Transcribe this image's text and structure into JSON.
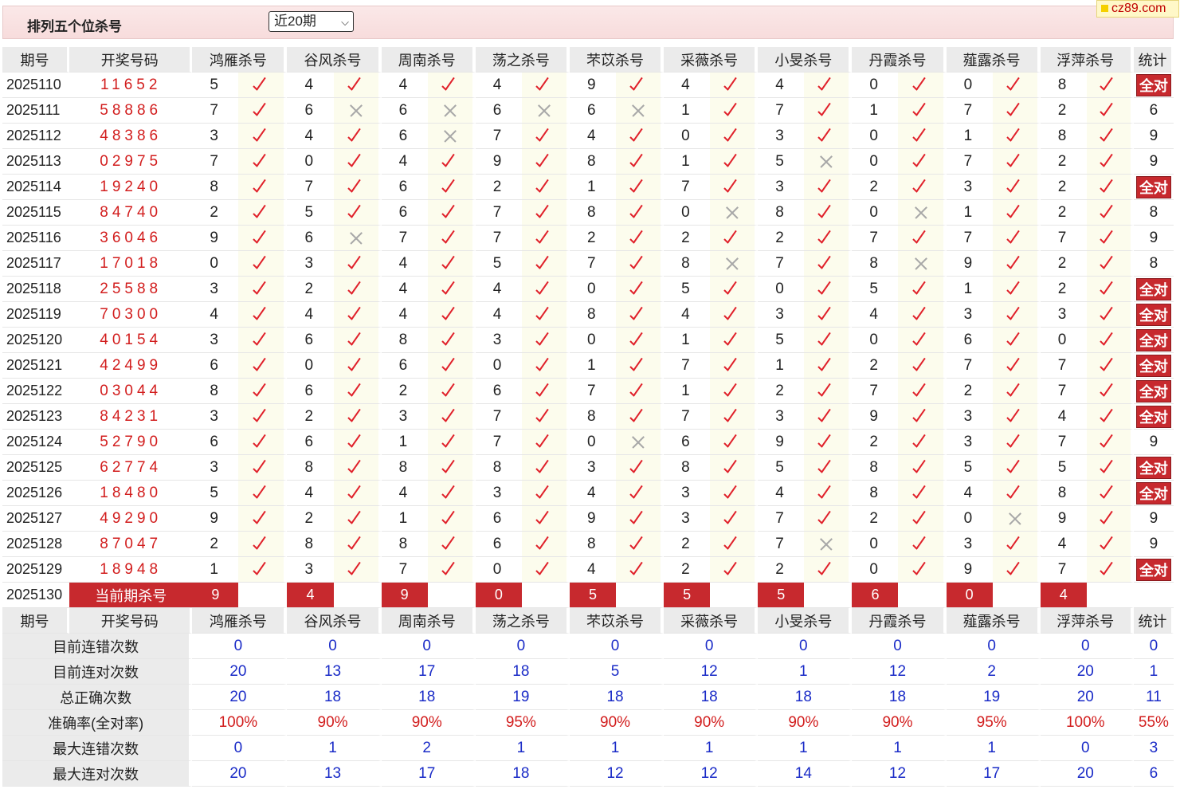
{
  "header": {
    "title": "排列五个位杀号",
    "period_select": "近20期",
    "brand": "cz89.com"
  },
  "columns": {
    "period": "期号",
    "draw": "开奖号码",
    "experts": [
      "鸿雁杀号",
      "谷风杀号",
      "周南杀号",
      "荡之杀号",
      "芣苡杀号",
      "采薇杀号",
      "小旻杀号",
      "丹霞杀号",
      "薤露杀号",
      "浮萍杀号"
    ],
    "stat": "统计"
  },
  "rows": [
    {
      "period": "2025110",
      "draw": "11652",
      "kills": [
        5,
        4,
        4,
        4,
        9,
        4,
        4,
        0,
        0,
        8
      ],
      "hits": [
        1,
        1,
        1,
        1,
        1,
        1,
        1,
        1,
        1,
        1
      ],
      "stat": "全对"
    },
    {
      "period": "2025111",
      "draw": "58886",
      "kills": [
        7,
        6,
        6,
        6,
        6,
        1,
        7,
        1,
        7,
        2
      ],
      "hits": [
        1,
        0,
        0,
        0,
        0,
        1,
        1,
        1,
        1,
        1
      ],
      "stat": "6"
    },
    {
      "period": "2025112",
      "draw": "48386",
      "kills": [
        3,
        4,
        6,
        7,
        4,
        0,
        3,
        0,
        1,
        8
      ],
      "hits": [
        1,
        1,
        0,
        1,
        1,
        1,
        1,
        1,
        1,
        1
      ],
      "stat": "9"
    },
    {
      "period": "2025113",
      "draw": "02975",
      "kills": [
        7,
        0,
        4,
        9,
        8,
        1,
        5,
        0,
        7,
        2
      ],
      "hits": [
        1,
        1,
        1,
        1,
        1,
        1,
        0,
        1,
        1,
        1
      ],
      "stat": "9"
    },
    {
      "period": "2025114",
      "draw": "19240",
      "kills": [
        8,
        7,
        6,
        2,
        1,
        7,
        3,
        2,
        3,
        2
      ],
      "hits": [
        1,
        1,
        1,
        1,
        1,
        1,
        1,
        1,
        1,
        1
      ],
      "stat": "全对"
    },
    {
      "period": "2025115",
      "draw": "84740",
      "kills": [
        2,
        5,
        6,
        7,
        8,
        0,
        8,
        0,
        1,
        2
      ],
      "hits": [
        1,
        1,
        1,
        1,
        1,
        0,
        1,
        0,
        1,
        1
      ],
      "stat": "8"
    },
    {
      "period": "2025116",
      "draw": "36046",
      "kills": [
        9,
        6,
        7,
        7,
        2,
        2,
        2,
        7,
        7,
        7
      ],
      "hits": [
        1,
        0,
        1,
        1,
        1,
        1,
        1,
        1,
        1,
        1
      ],
      "stat": "9"
    },
    {
      "period": "2025117",
      "draw": "17018",
      "kills": [
        0,
        3,
        4,
        5,
        7,
        8,
        7,
        8,
        9,
        2
      ],
      "hits": [
        1,
        1,
        1,
        1,
        1,
        0,
        1,
        0,
        1,
        1
      ],
      "stat": "8"
    },
    {
      "period": "2025118",
      "draw": "25588",
      "kills": [
        3,
        2,
        4,
        4,
        0,
        5,
        0,
        5,
        1,
        2
      ],
      "hits": [
        1,
        1,
        1,
        1,
        1,
        1,
        1,
        1,
        1,
        1
      ],
      "stat": "全对"
    },
    {
      "period": "2025119",
      "draw": "70300",
      "kills": [
        4,
        4,
        4,
        4,
        8,
        4,
        3,
        4,
        3,
        3
      ],
      "hits": [
        1,
        1,
        1,
        1,
        1,
        1,
        1,
        1,
        1,
        1
      ],
      "stat": "全对"
    },
    {
      "period": "2025120",
      "draw": "40154",
      "kills": [
        3,
        6,
        8,
        3,
        0,
        1,
        5,
        0,
        6,
        0
      ],
      "hits": [
        1,
        1,
        1,
        1,
        1,
        1,
        1,
        1,
        1,
        1
      ],
      "stat": "全对"
    },
    {
      "period": "2025121",
      "draw": "42499",
      "kills": [
        6,
        0,
        6,
        0,
        1,
        7,
        1,
        2,
        7,
        7
      ],
      "hits": [
        1,
        1,
        1,
        1,
        1,
        1,
        1,
        1,
        1,
        1
      ],
      "stat": "全对"
    },
    {
      "period": "2025122",
      "draw": "03044",
      "kills": [
        8,
        6,
        2,
        6,
        7,
        1,
        2,
        7,
        2,
        7
      ],
      "hits": [
        1,
        1,
        1,
        1,
        1,
        1,
        1,
        1,
        1,
        1
      ],
      "stat": "全对"
    },
    {
      "period": "2025123",
      "draw": "84231",
      "kills": [
        3,
        2,
        3,
        7,
        8,
        7,
        3,
        9,
        3,
        4
      ],
      "hits": [
        1,
        1,
        1,
        1,
        1,
        1,
        1,
        1,
        1,
        1
      ],
      "stat": "全对"
    },
    {
      "period": "2025124",
      "draw": "52790",
      "kills": [
        6,
        6,
        1,
        7,
        0,
        6,
        9,
        2,
        3,
        7
      ],
      "hits": [
        1,
        1,
        1,
        1,
        0,
        1,
        1,
        1,
        1,
        1
      ],
      "stat": "9"
    },
    {
      "period": "2025125",
      "draw": "62774",
      "kills": [
        3,
        8,
        8,
        8,
        3,
        8,
        5,
        8,
        5,
        5
      ],
      "hits": [
        1,
        1,
        1,
        1,
        1,
        1,
        1,
        1,
        1,
        1
      ],
      "stat": "全对"
    },
    {
      "period": "2025126",
      "draw": "18480",
      "kills": [
        5,
        4,
        4,
        3,
        4,
        3,
        4,
        8,
        4,
        8
      ],
      "hits": [
        1,
        1,
        1,
        1,
        1,
        1,
        1,
        1,
        1,
        1
      ],
      "stat": "全对"
    },
    {
      "period": "2025127",
      "draw": "49290",
      "kills": [
        9,
        2,
        1,
        6,
        9,
        3,
        7,
        2,
        0,
        9
      ],
      "hits": [
        1,
        1,
        1,
        1,
        1,
        1,
        1,
        1,
        0,
        1
      ],
      "stat": "9"
    },
    {
      "period": "2025128",
      "draw": "87047",
      "kills": [
        2,
        8,
        8,
        6,
        8,
        2,
        7,
        0,
        3,
        4
      ],
      "hits": [
        1,
        1,
        1,
        1,
        1,
        1,
        0,
        1,
        1,
        1
      ],
      "stat": "9"
    },
    {
      "period": "2025129",
      "draw": "18948",
      "kills": [
        1,
        3,
        7,
        0,
        4,
        2,
        2,
        0,
        9,
        7
      ],
      "hits": [
        1,
        1,
        1,
        1,
        1,
        1,
        1,
        1,
        1,
        1
      ],
      "stat": "全对"
    }
  ],
  "current": {
    "period": "2025130",
    "label": "当前期杀号",
    "kills": [
      9,
      4,
      9,
      0,
      5,
      5,
      5,
      6,
      0,
      4
    ]
  },
  "summary": [
    {
      "label": "目前连错次数",
      "values": [
        "0",
        "0",
        "0",
        "0",
        "0",
        "0",
        "0",
        "0",
        "0",
        "0"
      ],
      "stat": "0",
      "pct": false
    },
    {
      "label": "目前连对次数",
      "values": [
        "20",
        "13",
        "17",
        "18",
        "5",
        "12",
        "1",
        "12",
        "2",
        "20"
      ],
      "stat": "1",
      "pct": false
    },
    {
      "label": "总正确次数",
      "values": [
        "20",
        "18",
        "18",
        "19",
        "18",
        "18",
        "18",
        "18",
        "19",
        "20"
      ],
      "stat": "11",
      "pct": false
    },
    {
      "label": "准确率(全对率)",
      "values": [
        "100%",
        "90%",
        "90%",
        "95%",
        "90%",
        "90%",
        "90%",
        "90%",
        "95%",
        "100%"
      ],
      "stat": "55%",
      "pct": true
    },
    {
      "label": "最大连错次数",
      "values": [
        "0",
        "1",
        "2",
        "1",
        "1",
        "1",
        "1",
        "1",
        "1",
        "0"
      ],
      "stat": "3",
      "pct": false
    },
    {
      "label": "最大连对次数",
      "values": [
        "20",
        "13",
        "17",
        "18",
        "12",
        "12",
        "14",
        "12",
        "17",
        "20"
      ],
      "stat": "6",
      "pct": false
    }
  ],
  "colors": {
    "accent_red": "#c7292e",
    "draw_red": "#d21d1d",
    "summary_blue": "#1a2bc7",
    "tick_red": "#e0202a",
    "cross_gray": "#a8a8a8"
  }
}
